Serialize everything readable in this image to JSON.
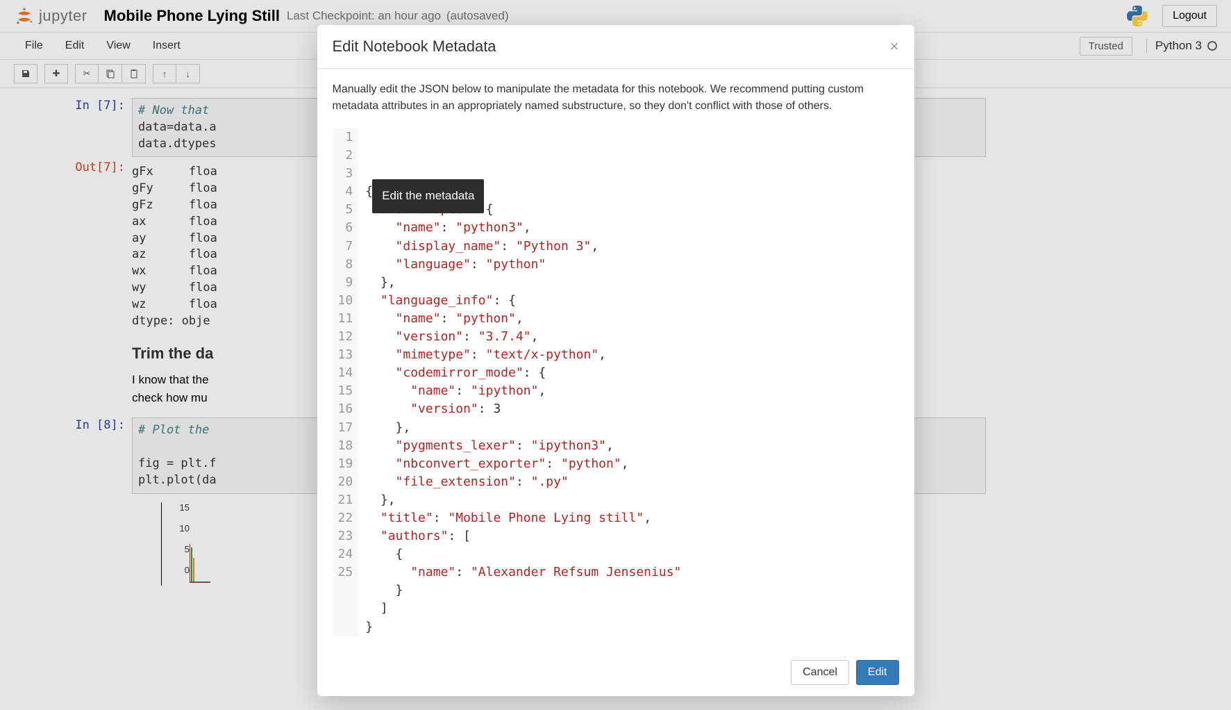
{
  "header": {
    "logo_text": "jupyter",
    "notebook_title": "Mobile Phone Lying Still",
    "checkpoint": "Last Checkpoint: an hour ago",
    "autosaved": "(autosaved)",
    "logout": "Logout"
  },
  "menubar": {
    "items": [
      "File",
      "Edit",
      "View",
      "Insert"
    ],
    "trusted": "Trusted",
    "kernel": "Python 3"
  },
  "notebook": {
    "cells": {
      "c0": {
        "prompt_in": "In [7]:",
        "code": "# Now that\ndata=data.a\ndata.dtypes"
      },
      "c0_out": {
        "prompt": "Out[7]:",
        "text": "gFx     floa\ngFy     floa\ngFz     floa\nax      floa\nay      floa\naz      floa\nwx      floa\nwy      floa\nwz      floa\ndtype: obje"
      },
      "md": {
        "heading": "Trim the da",
        "body": "I know that the                                                                                                                           slightly. First, we need to\ncheck how mu"
      },
      "c1": {
        "prompt_in": "In [8]:",
        "code": "# Plot the\n\nfig = plt.f\nplt.plot(da"
      }
    }
  },
  "modal": {
    "title": "Edit Notebook Metadata",
    "description": "Manually edit the JSON below to manipulate the metadata for this notebook. We recommend putting custom metadata attributes in an appropriately named substructure, so they don't conflict with those of others.",
    "tooltip": "Edit the metadata",
    "cancel": "Cancel",
    "ok": "Edit",
    "lines": [
      "{",
      "  \"kernelspec\": {",
      "    \"name\": \"python3\",",
      "    \"display_name\": \"Python 3\",",
      "    \"language\": \"python\"",
      "  },",
      "  \"language_info\": {",
      "    \"name\": \"python\",",
      "    \"version\": \"3.7.4\",",
      "    \"mimetype\": \"text/x-python\",",
      "    \"codemirror_mode\": {",
      "      \"name\": \"ipython\",",
      "      \"version\": 3",
      "    },",
      "    \"pygments_lexer\": \"ipython3\",",
      "    \"nbconvert_exporter\": \"python\",",
      "    \"file_extension\": \".py\"",
      "  },",
      "  \"title\": \"Mobile Phone Lying still\",",
      "  \"authors\": [",
      "    {",
      "      \"name\": \"Alexander Refsum Jensenius\"",
      "    }",
      "  ]",
      "}"
    ]
  },
  "chart_data": {
    "type": "line",
    "y_ticks": [
      15,
      10,
      5,
      0
    ],
    "ylim": [
      0,
      15
    ]
  }
}
